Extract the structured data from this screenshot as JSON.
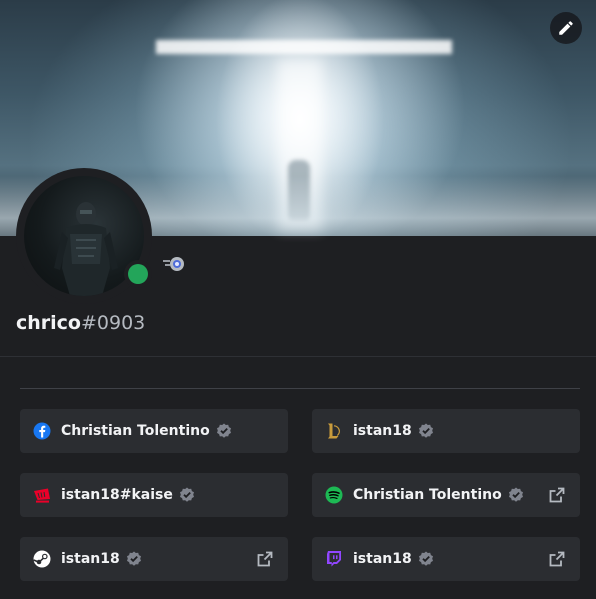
{
  "profile": {
    "username": "chrico",
    "discriminator": "#0903",
    "status": "online",
    "status_color": "#23a55a"
  },
  "icons": {
    "edit": "pencil-icon",
    "badge": "nitro-boost-badge-icon"
  },
  "connections": [
    {
      "service": "facebook",
      "name": "Christian Tolentino",
      "verified": true,
      "external_link": false,
      "color": "#1877f2"
    },
    {
      "service": "league-of-legends",
      "name": "istan18",
      "verified": true,
      "external_link": false,
      "color": "#c89b3c"
    },
    {
      "service": "riot-games",
      "name": "istan18#kaise",
      "verified": true,
      "external_link": false,
      "color": "#eb0029"
    },
    {
      "service": "spotify",
      "name": "Christian Tolentino",
      "verified": true,
      "external_link": true,
      "color": "#1db954"
    },
    {
      "service": "steam",
      "name": "istan18",
      "verified": true,
      "external_link": true,
      "color": "#ffffff"
    },
    {
      "service": "twitch",
      "name": "istan18",
      "verified": true,
      "external_link": true,
      "color": "#9146ff"
    }
  ]
}
